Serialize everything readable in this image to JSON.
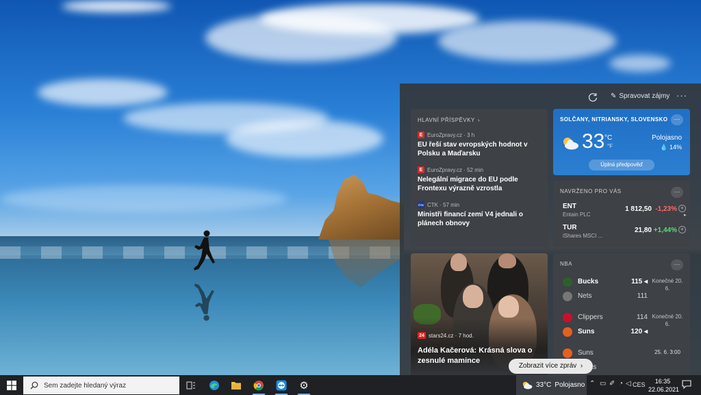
{
  "panel": {
    "manage_label": "Spravovat zájmy",
    "more_label": "···"
  },
  "top_stories": {
    "title": "HLAVNÍ PŘÍSPĚVKY",
    "items": [
      {
        "source": "EuroZpravy.cz · 3 h",
        "headline": "EU řeší stav evropských hodnot v Polsku a Maďarsku",
        "logo": "E",
        "logo_color": "#d32f2f"
      },
      {
        "source": "EuroZpravy.cz · 52 min",
        "headline": "Nelegální migrace do EU podle Frontexu výrazně vzrostla",
        "logo": "E",
        "logo_color": "#d32f2f"
      },
      {
        "source": "CTK · 57 min",
        "headline": "Ministři financí zemí V4 jednali o plánech obnovy",
        "logo": "ČTK",
        "logo_color": "#1e3a8a"
      }
    ]
  },
  "weather": {
    "location": "SOLČANY, NITRIANSKY, SLOVENSKO",
    "temp": "33",
    "unit_c": "°C",
    "unit_f": "°F",
    "condition": "Polojasno",
    "rain": "💧 14%",
    "forecast_button": "Úplná předpověď",
    "more": "···"
  },
  "stocks": {
    "title": "NAVRŽENO PRO VÁS",
    "more": "···",
    "items": [
      {
        "symbol": "ENT",
        "name": "Entain PLC",
        "price": "1 812,50",
        "change": "-1,23%",
        "change_color": "#ff6b6b"
      },
      {
        "symbol": "TUR",
        "name": "iShares MSCI ...",
        "price": "21,80",
        "change": "+1,44%",
        "change_color": "#5ddc7a"
      }
    ],
    "next_arrow": "▸"
  },
  "photo_story": {
    "source": "stars24.cz · 7 hod.",
    "source_logo": "24",
    "headline": "Adéla Kačerová: Krásná slova o zesnulé mamince"
  },
  "nba": {
    "title": "NBA",
    "more": "···",
    "games": [
      {
        "teams": [
          {
            "name": "Bucks",
            "score": "115 ◂",
            "win": true,
            "color": "#2e5e2e"
          },
          {
            "name": "Nets",
            "score": "111",
            "win": false,
            "color": "#777"
          }
        ],
        "status": "Konečné 20. 6."
      },
      {
        "teams": [
          {
            "name": "Clippers",
            "score": "114",
            "win": false,
            "color": "#c8102e"
          },
          {
            "name": "Suns",
            "score": "120 ◂",
            "win": true,
            "color": "#e56020"
          }
        ],
        "status": "Konečné 20. 6."
      },
      {
        "teams": [
          {
            "name": "Suns",
            "score": "",
            "win": false,
            "color": "#e56020"
          },
          {
            "name": "Bucks",
            "score": "",
            "win": false,
            "color": "#2e5e2e"
          }
        ],
        "status": "25. 6. 3:00"
      }
    ]
  },
  "more_news_button": "Zobrazit více zpráv",
  "taskbar": {
    "search_placeholder": "Sem zadejte hledaný výraz",
    "weather_temp": "33°C",
    "weather_condition": "Polojasno",
    "language": "CES",
    "time": "16:35",
    "date": "22.06.2021"
  }
}
